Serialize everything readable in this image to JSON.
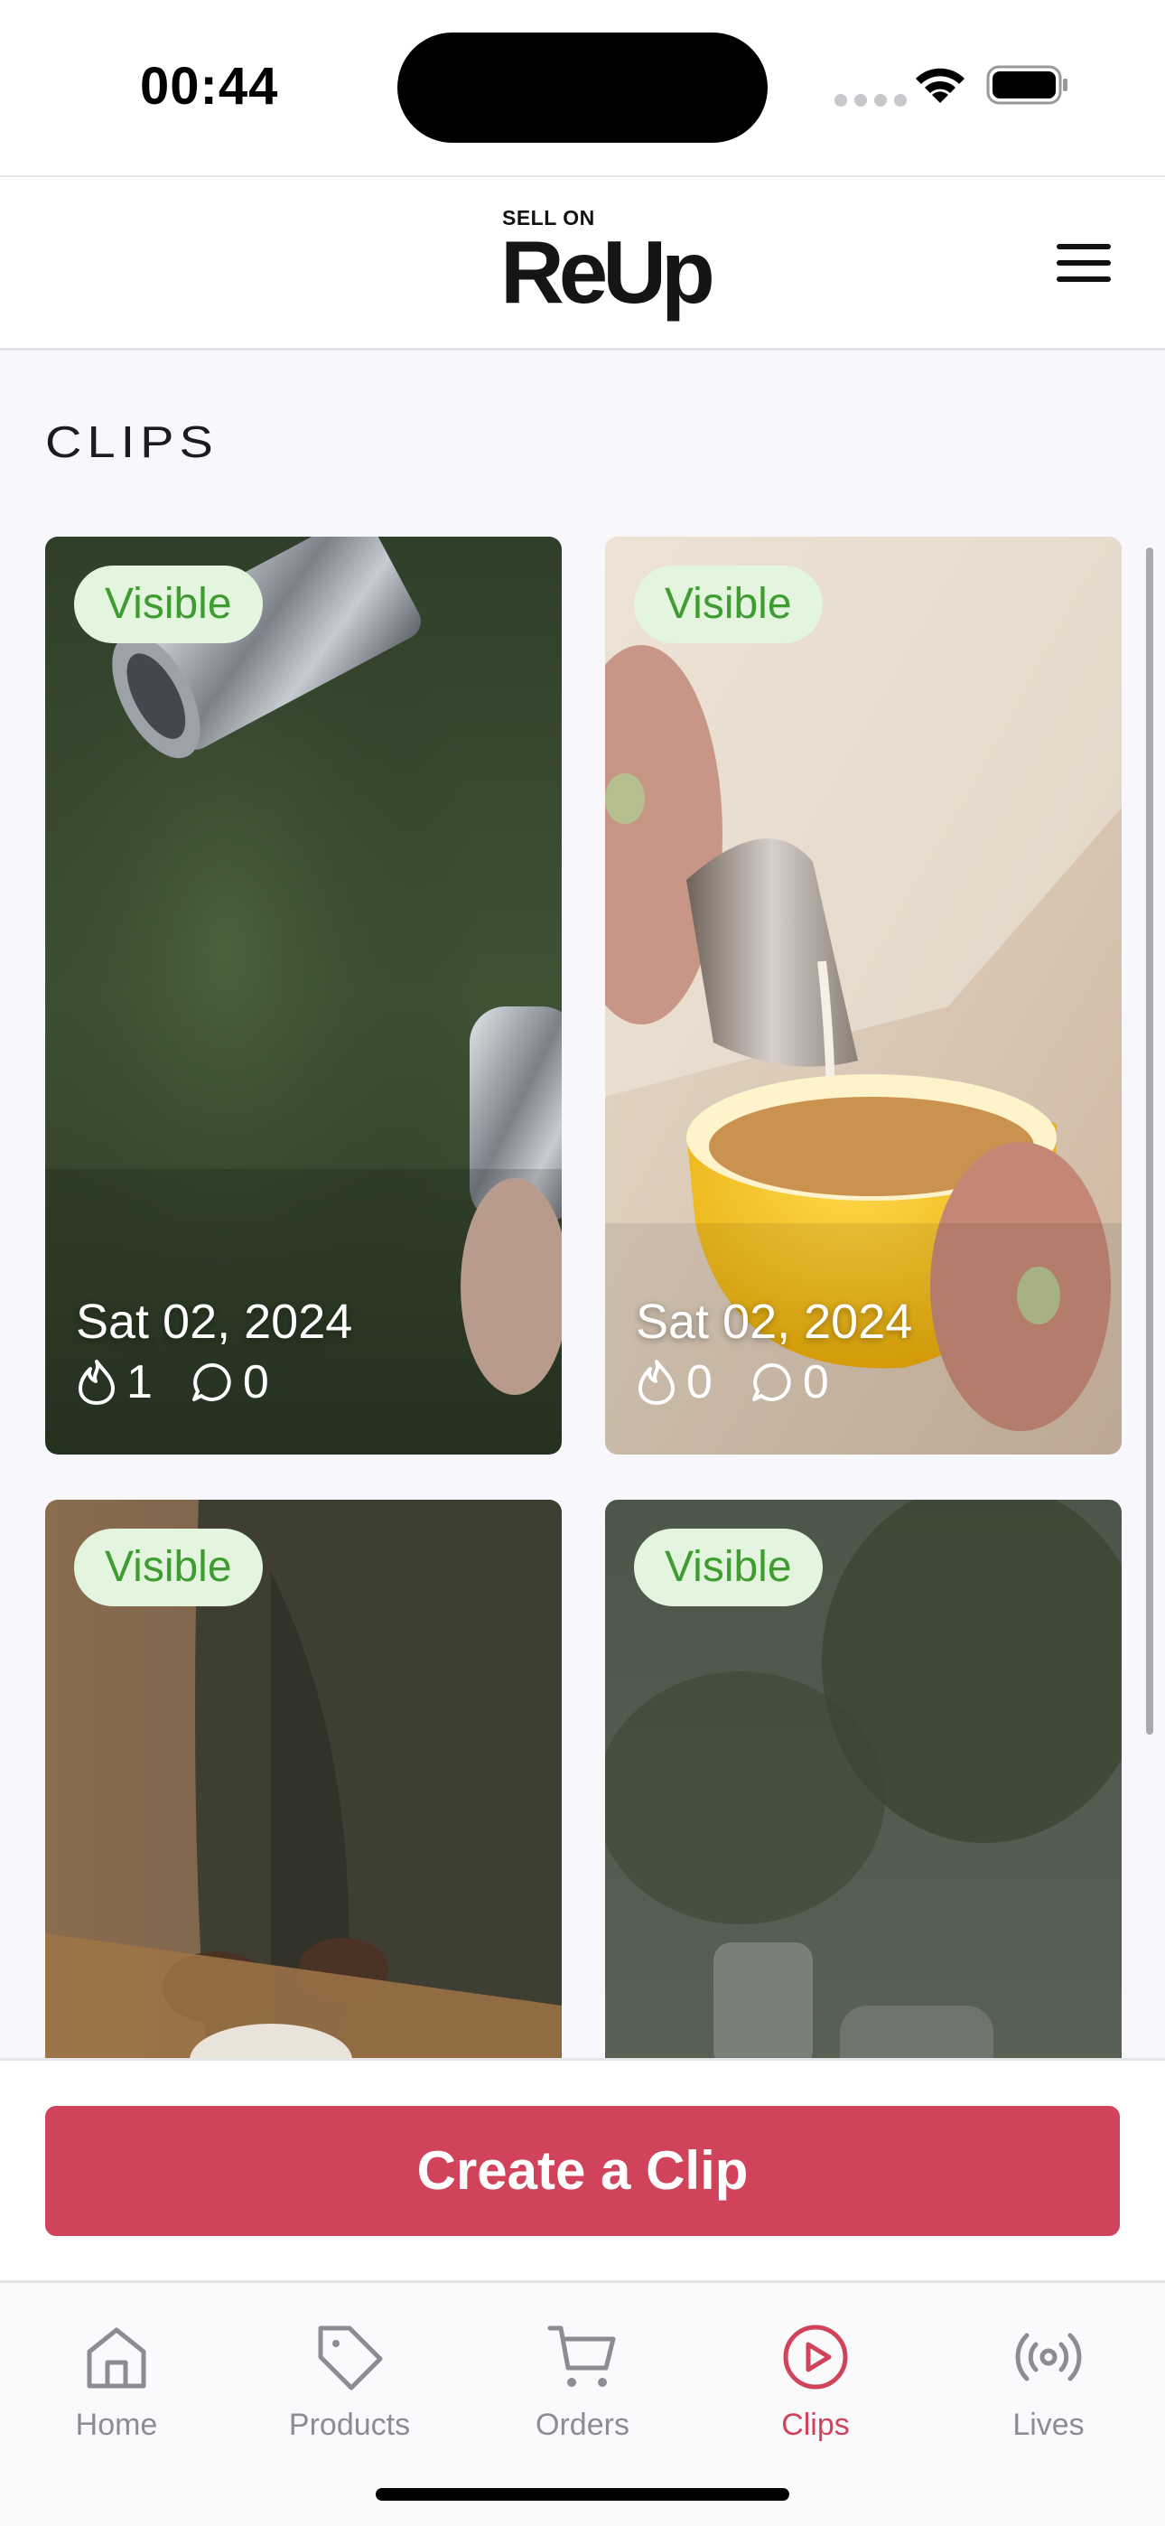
{
  "status_bar": {
    "time": "00:44"
  },
  "header": {
    "logo_small": "SELL ON",
    "logo_main": "ReUp",
    "menu_icon": "hamburger-menu-icon"
  },
  "page": {
    "title": "CLIPS"
  },
  "clips": [
    {
      "badge": "Visible",
      "date": "Sat 02, 2024",
      "likes": "1",
      "comments": "0"
    },
    {
      "badge": "Visible",
      "date": "Sat 02, 2024",
      "likes": "0",
      "comments": "0"
    },
    {
      "badge": "Visible"
    },
    {
      "badge": "Visible"
    }
  ],
  "actions": {
    "create_label": "Create a Clip"
  },
  "tabs": [
    {
      "label": "Home",
      "icon": "home-icon"
    },
    {
      "label": "Products",
      "icon": "tag-icon"
    },
    {
      "label": "Orders",
      "icon": "cart-icon"
    },
    {
      "label": "Clips",
      "icon": "play-circle-icon",
      "active": true
    },
    {
      "label": "Lives",
      "icon": "broadcast-icon"
    }
  ],
  "colors": {
    "accent": "#d0435b",
    "badge_bg": "#e3f5de",
    "badge_text": "#3f9c31",
    "tab_inactive": "#8c8c94"
  }
}
